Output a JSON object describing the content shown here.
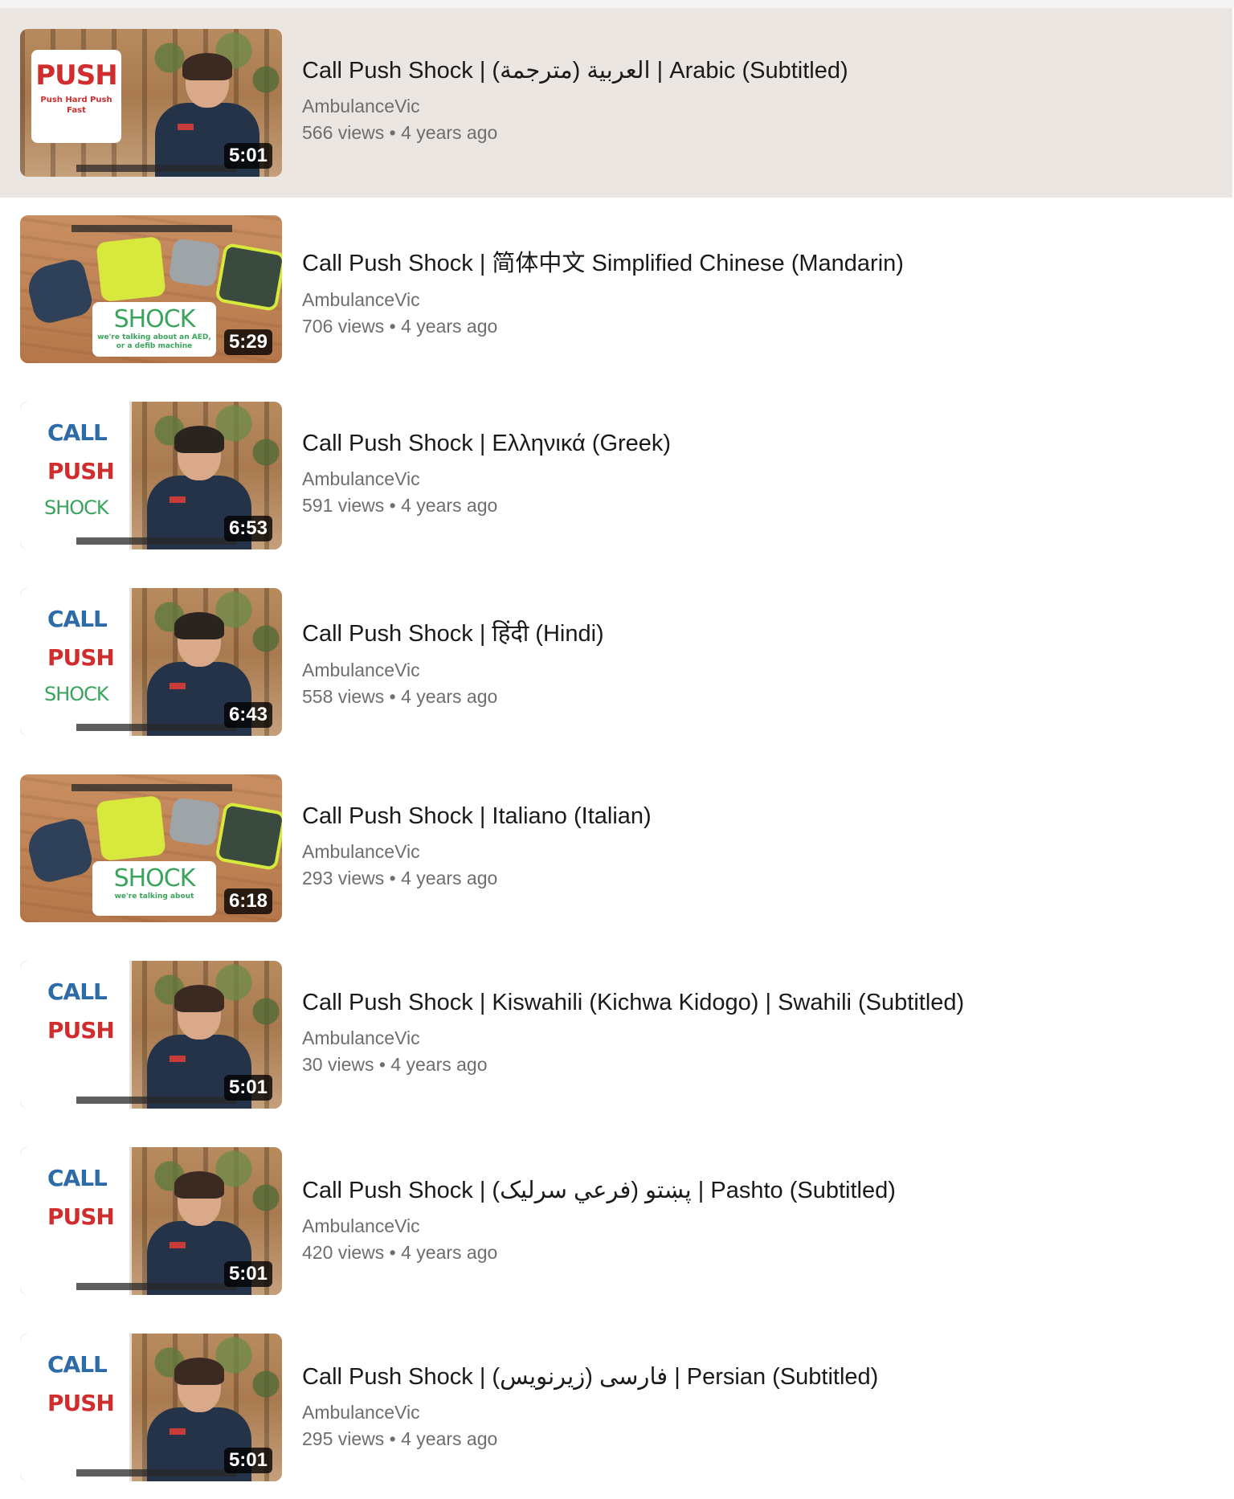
{
  "videos": [
    {
      "title": "Call Push Shock | العربية (مترجمة) | Arabic (Subtitled)",
      "channel": "AmbulanceVic",
      "stats": "566 views • 4 years ago",
      "duration": "5:01",
      "thumb": "push-card",
      "card_big": "PUSH",
      "card_small": "Push Hard Push Fast"
    },
    {
      "title": "Call Push Shock | 简体中文 Simplified Chinese (Mandarin)",
      "channel": "AmbulanceVic",
      "stats": "706 views • 4 years ago",
      "duration": "5:29",
      "thumb": "aed-table",
      "card_big": "SHOCK",
      "card_small": "we're talking about an AED, or a defib machine"
    },
    {
      "title": "Call Push Shock | Ελληνικά (Greek)",
      "channel": "AmbulanceVic",
      "stats": "591 views • 4 years ago",
      "duration": "6:53",
      "thumb": "cps-man",
      "cps": [
        "CALL",
        "PUSH",
        "SHOCK"
      ]
    },
    {
      "title": "Call Push Shock | हिंदी (Hindi)",
      "channel": "AmbulanceVic",
      "stats": "558 views • 4 years ago",
      "duration": "6:43",
      "thumb": "cps-man",
      "cps": [
        "CALL",
        "PUSH",
        "SHOCK"
      ]
    },
    {
      "title": "Call Push Shock | Italiano (Italian)",
      "channel": "AmbulanceVic",
      "stats": "293 views • 4 years ago",
      "duration": "6:18",
      "thumb": "aed-table",
      "card_big": "SHOCK",
      "card_small": "we're talking about"
    },
    {
      "title": "Call Push Shock | Kiswahili (Kichwa Kidogo) | Swahili (Subtitled)",
      "channel": "AmbulanceVic",
      "stats": "30 views • 4 years ago",
      "duration": "5:01",
      "thumb": "cps-woman",
      "cps": [
        "CALL",
        "PUSH"
      ]
    },
    {
      "title": "Call Push Shock | پښتو (فرعي سرليک) | Pashto (Subtitled)",
      "channel": "AmbulanceVic",
      "stats": "420 views • 4 years ago",
      "duration": "5:01",
      "thumb": "cps-woman",
      "cps": [
        "CALL",
        "PUSH"
      ]
    },
    {
      "title": "Call Push Shock | فارسی (زیرنویس) | Persian (Subtitled)",
      "channel": "AmbulanceVic",
      "stats": "295 views • 4 years ago",
      "duration": "5:01",
      "thumb": "cps-woman",
      "cps": [
        "CALL",
        "PUSH"
      ]
    }
  ],
  "colors": {
    "selected_bg": "#ece6e2",
    "push_red": "#d02e2e",
    "call_blue": "#2d6aa8",
    "shock_green": "#3aa45c"
  }
}
